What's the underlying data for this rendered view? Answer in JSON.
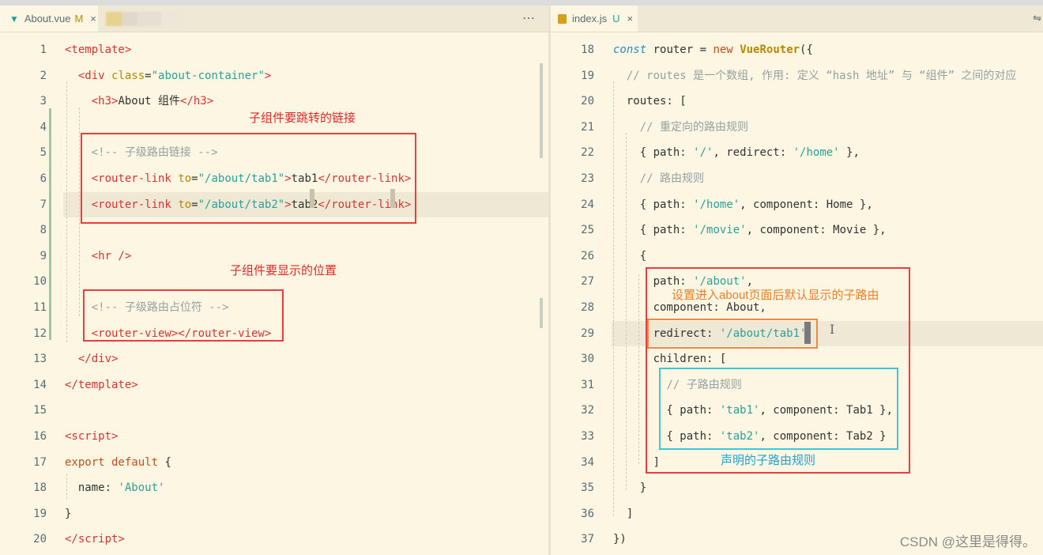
{
  "left_tab": {
    "icon": "vue-icon",
    "name": "About.vue",
    "status": "M",
    "close": "×"
  },
  "left_more": "⋯",
  "right_tab": {
    "icon": "js-icon",
    "name": "index.js",
    "status": "U",
    "close": "×"
  },
  "left_lines": [
    {
      "num": "1",
      "html": "<span class=\"tag\">&lt;template&gt;</span>"
    },
    {
      "num": "2",
      "html": "  <span class=\"tag\">&lt;div</span> <span class=\"attr\">class</span>=<span class=\"str\">\"about-container\"</span><span class=\"tag\">&gt;</span>"
    },
    {
      "num": "3",
      "html": "    <span class=\"tag\">&lt;h3&gt;</span>About 组件<span class=\"tag\">&lt;/h3&gt;</span>"
    },
    {
      "num": "4",
      "html": ""
    },
    {
      "num": "5",
      "html": "    <span class=\"cmt\">&lt;!-- 子级路由链接 --&gt;</span>"
    },
    {
      "num": "6",
      "html": "    <span class=\"tag\">&lt;router-link</span> <span class=\"attr\">to</span>=<span class=\"str\">\"/about/tab1\"</span><span class=\"tag\">&gt;</span>tab1<span class=\"tag\">&lt;/router-link&gt;</span>"
    },
    {
      "num": "7",
      "html": "    <span class=\"tag\">&lt;router-link</span> <span class=\"attr\">to</span>=<span class=\"str\">\"/about/tab2\"</span><span class=\"tag\">&gt;</span>tab2<span class=\"tag\">&lt;/router-link&gt;</span>"
    },
    {
      "num": "8",
      "html": ""
    },
    {
      "num": "9",
      "html": "    <span class=\"tag\">&lt;hr /&gt;</span>"
    },
    {
      "num": "10",
      "html": ""
    },
    {
      "num": "11",
      "html": "    <span class=\"cmt\">&lt;!-- 子级路由占位符 --&gt;</span>"
    },
    {
      "num": "12",
      "html": "    <span class=\"tag\">&lt;router-view&gt;&lt;/router-view&gt;</span>"
    },
    {
      "num": "13",
      "html": "  <span class=\"tag\">&lt;/div&gt;</span>"
    },
    {
      "num": "14",
      "html": "<span class=\"tag\">&lt;/template&gt;</span>"
    },
    {
      "num": "15",
      "html": ""
    },
    {
      "num": "16",
      "html": "<span class=\"tag\">&lt;script&gt;</span>"
    },
    {
      "num": "17",
      "html": "<span class=\"kw\">export default</span> {"
    },
    {
      "num": "18",
      "html": "  name: <span class=\"str\">'About'</span>"
    },
    {
      "num": "19",
      "html": "}"
    },
    {
      "num": "20",
      "html": "<span class=\"tag\">&lt;/script&gt;</span>"
    }
  ],
  "right_lines": [
    {
      "num": "18",
      "html": "<span class=\"kwi\">const</span> router = <span class=\"kw\">new</span> <span class=\"cls\">VueRouter</span>({"
    },
    {
      "num": "19",
      "html": "  <span class=\"cmt\">// routes 是一个数组, 作用: 定义 “hash 地址” 与 “组件” 之间的对应</span>"
    },
    {
      "num": "20",
      "html": "  routes: ["
    },
    {
      "num": "21",
      "html": "    <span class=\"cmt\">// 重定向的路由规则</span>"
    },
    {
      "num": "22",
      "html": "    { path: <span class=\"str\">'/'</span>, redirect: <span class=\"str\">'/home'</span> },"
    },
    {
      "num": "23",
      "html": "    <span class=\"cmt\">// 路由规则</span>"
    },
    {
      "num": "24",
      "html": "    { path: <span class=\"str\">'/home'</span>, component: Home },"
    },
    {
      "num": "25",
      "html": "    { path: <span class=\"str\">'/movie'</span>, component: Movie },"
    },
    {
      "num": "26",
      "html": "    {"
    },
    {
      "num": "27",
      "html": "      path: <span class=\"str\">'/about'</span>,"
    },
    {
      "num": "28",
      "html": "      component: About,"
    },
    {
      "num": "29",
      "html": "      redirect: <span class=\"str\">'/about/tab1'</span>,"
    },
    {
      "num": "30",
      "html": "      children: ["
    },
    {
      "num": "31",
      "html": "        <span class=\"cmt\">// 子路由规则</span>"
    },
    {
      "num": "32",
      "html": "        { path: <span class=\"str\">'tab1'</span>, component: Tab1 },"
    },
    {
      "num": "33",
      "html": "        { path: <span class=\"str\">'tab2'</span>, component: Tab2 }"
    },
    {
      "num": "34",
      "html": "      ]"
    },
    {
      "num": "35",
      "html": "    }"
    },
    {
      "num": "36",
      "html": "  ]"
    },
    {
      "num": "37",
      "html": "})"
    }
  ],
  "annotations": {
    "link_target": "子组件要跳转的链接",
    "display_position": "子组件要显示的位置",
    "default_child": "设置进入about页面后默认显示的子路由",
    "child_rules": "声明的子路由规则"
  },
  "watermark": "CSDN @这里是得得。"
}
